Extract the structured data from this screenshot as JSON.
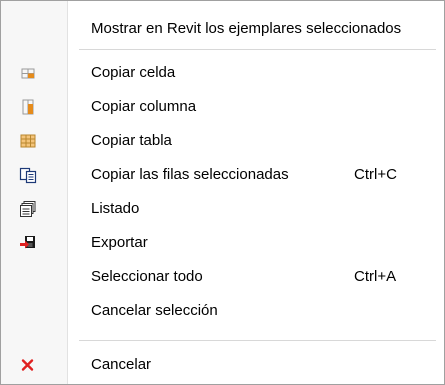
{
  "menu": {
    "items": [
      {
        "label": "Mostrar en Revit los ejemplares seleccionados",
        "shortcut": ""
      },
      {
        "label": "Copiar celda",
        "shortcut": "",
        "icon": "copy-cell-icon"
      },
      {
        "label": "Copiar columna",
        "shortcut": "",
        "icon": "copy-column-icon"
      },
      {
        "label": "Copiar tabla",
        "shortcut": "",
        "icon": "copy-table-icon"
      },
      {
        "label": "Copiar las filas seleccionadas",
        "shortcut": "Ctrl+C",
        "icon": "copy-rows-icon"
      },
      {
        "label": "Listado",
        "shortcut": "",
        "icon": "listing-icon"
      },
      {
        "label": "Exportar",
        "shortcut": "",
        "icon": "export-icon"
      },
      {
        "label": "Seleccionar todo",
        "shortcut": "Ctrl+A"
      },
      {
        "label": "Cancelar selección",
        "shortcut": ""
      },
      {
        "label": "Cancelar",
        "shortcut": "",
        "icon": "cancel-icon"
      }
    ]
  },
  "colors": {
    "accent_orange": "#e58b1b",
    "cancel_red": "#e02020"
  }
}
